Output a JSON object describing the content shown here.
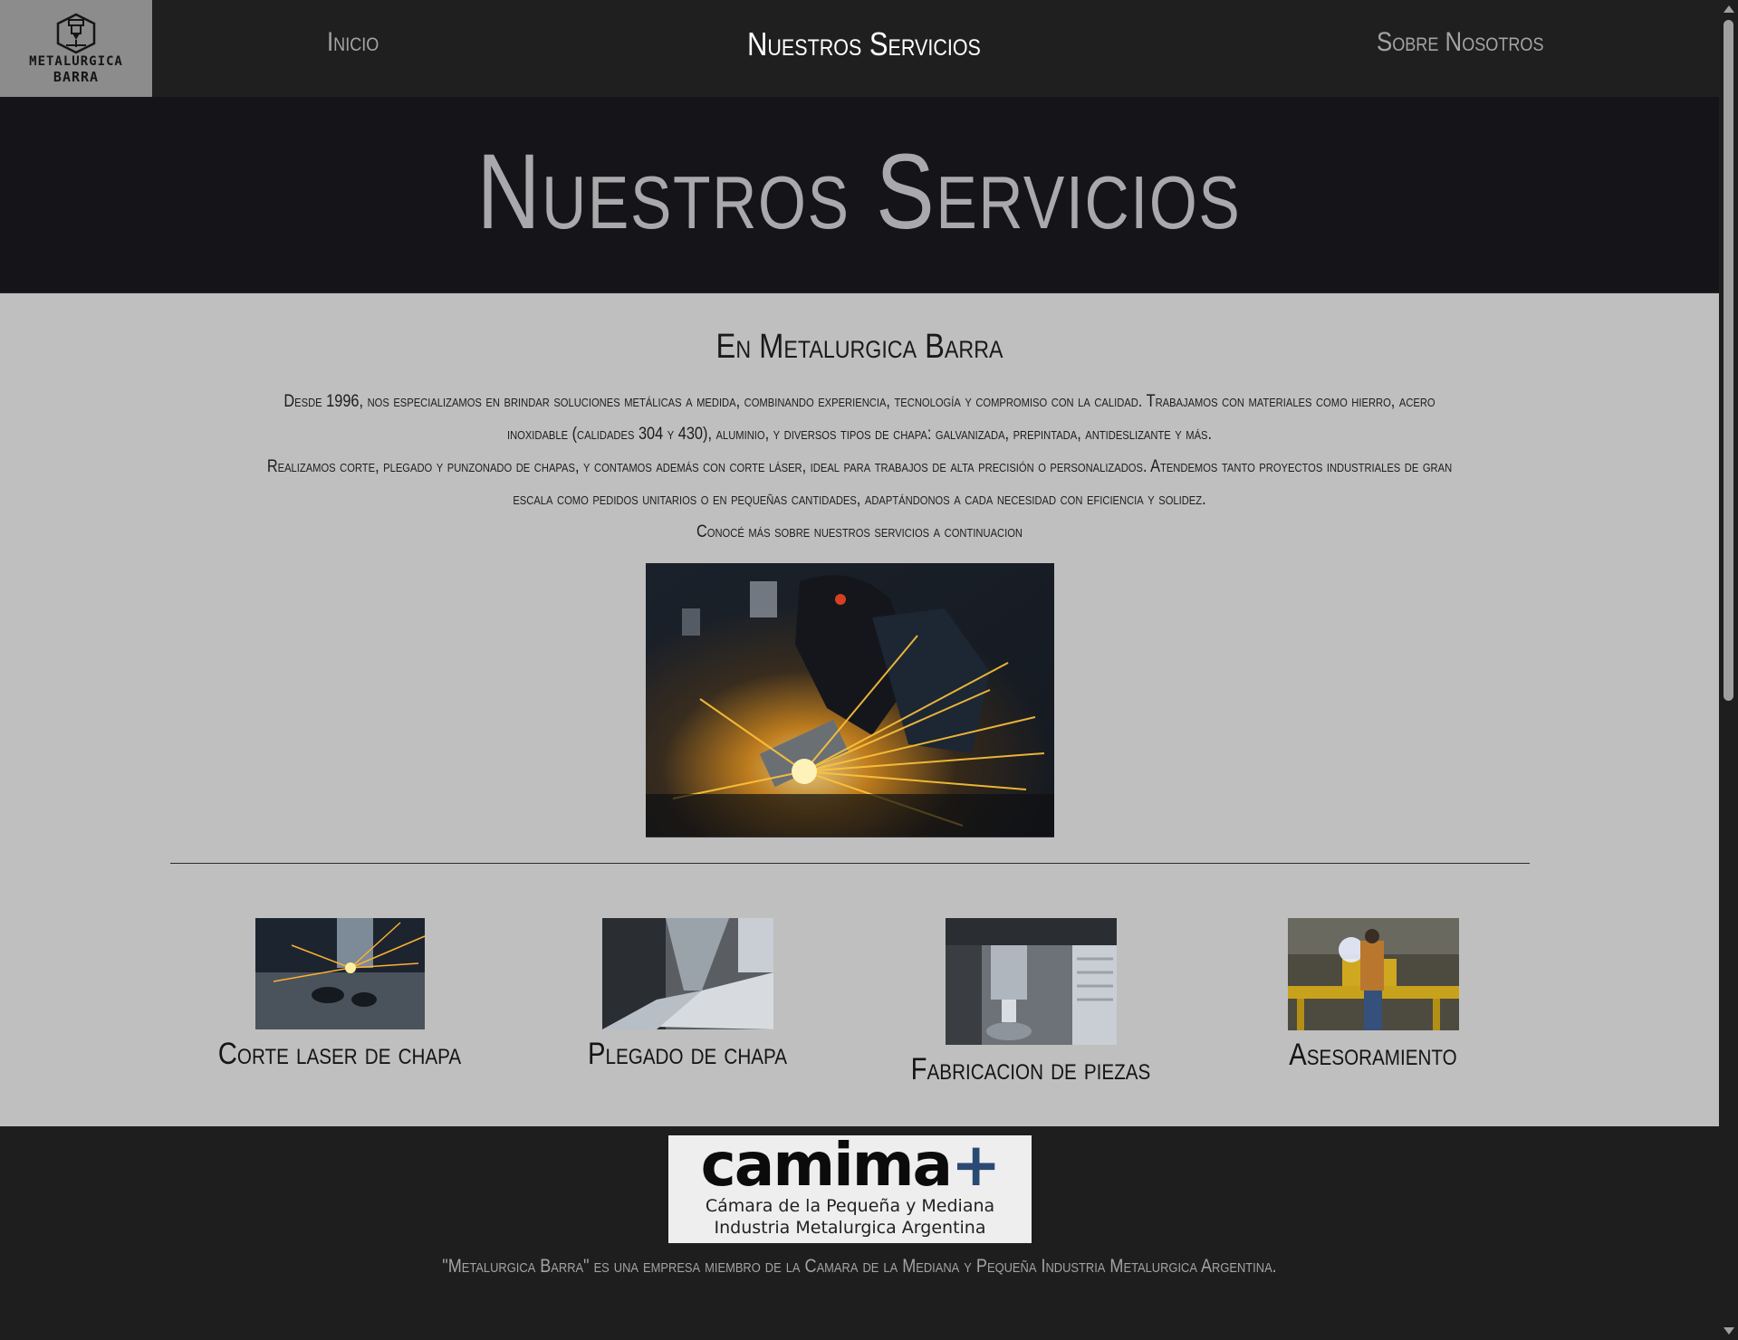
{
  "nav": {
    "logo_line1": "METALURGICA",
    "logo_line2": "BARRA",
    "links": [
      {
        "label": "Inicio",
        "active": false
      },
      {
        "label": "Nuestros Servicios",
        "active": true
      },
      {
        "label": "Sobre Nosotros",
        "active": false
      }
    ]
  },
  "hero": {
    "title": "Nuestros Servicios"
  },
  "main": {
    "heading": "En Metalurgica Barra",
    "paragraphs": [
      "Desde 1996, nos especializamos en brindar soluciones metálicas a medida, combinando experiencia, tecnología y compromiso con la calidad. Trabajamos con materiales como hierro, acero inoxidable (calidades 304 y 430), aluminio, y diversos tipos de chapa: galvanizada, prepintada, antideslizante y más.",
      "Realizamos corte, plegado y punzonado de chapas, y contamos además con corte láser, ideal para trabajos de alta precisión o personalizados. Atendemos tanto proyectos industriales de gran escala como pedidos unitarios o en pequeñas cantidades, adaptándonos a cada necesidad con eficiencia y solidez.",
      "Conocé más sobre nuestros servicios a continuacion"
    ]
  },
  "services": [
    {
      "label": "Corte laser de chapa"
    },
    {
      "label": "Plegado de chapa"
    },
    {
      "label": "Fabricacion de piezas"
    },
    {
      "label": "Asesoramiento"
    }
  ],
  "footer": {
    "partner_wordmark_a": "camima",
    "partner_wordmark_b": "+",
    "partner_sub1": "Cámara de la Pequeña y Mediana",
    "partner_sub2": "Industria Metalurgica Argentina",
    "text": "\"Metalurgica Barra\" es una empresa miembro de la Camara de la Mediana y Pequeña Industria Metalurgica Argentina."
  }
}
